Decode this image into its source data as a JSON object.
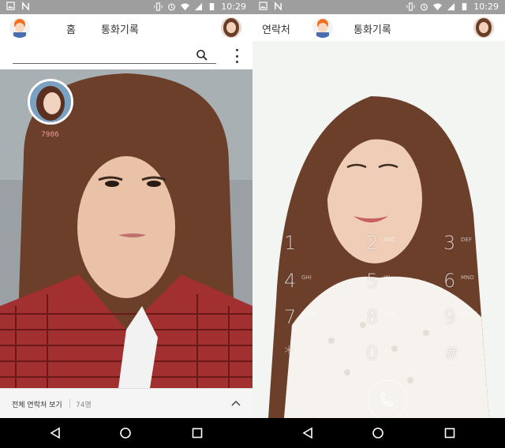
{
  "status": {
    "time": "10:29"
  },
  "left": {
    "tabs": [
      {
        "label": "홈"
      },
      {
        "label": "통화기록"
      }
    ],
    "search": {
      "placeholder": ""
    },
    "badge_number": "7986",
    "contacts_bar": {
      "label": "전체 연락처 보기",
      "count": "74명"
    }
  },
  "right": {
    "tabs": [
      {
        "label": "연락처"
      },
      {
        "label": "통화기록"
      }
    ],
    "keypad": {
      "keys": [
        "1",
        "2",
        "3",
        "4",
        "5",
        "6",
        "7",
        "8",
        "9",
        "*",
        "0",
        "#"
      ],
      "subs": [
        "",
        "ABC",
        "DEF",
        "GHI",
        "JKL",
        "MNO",
        "PQRS",
        "TUV",
        "WXYZ",
        "",
        "+",
        ""
      ]
    }
  },
  "colors": {
    "statusbar": "#9e9e9e",
    "navbar": "#000000",
    "badge_text": "#e89a9a"
  },
  "icons": [
    "image-icon",
    "n-icon",
    "vibrate-icon",
    "alarm-icon",
    "wifi-icon",
    "signal-icon",
    "battery-icon",
    "search-icon",
    "more-icon",
    "chevron-up-icon",
    "back-icon",
    "home-icon",
    "recents-icon"
  ]
}
